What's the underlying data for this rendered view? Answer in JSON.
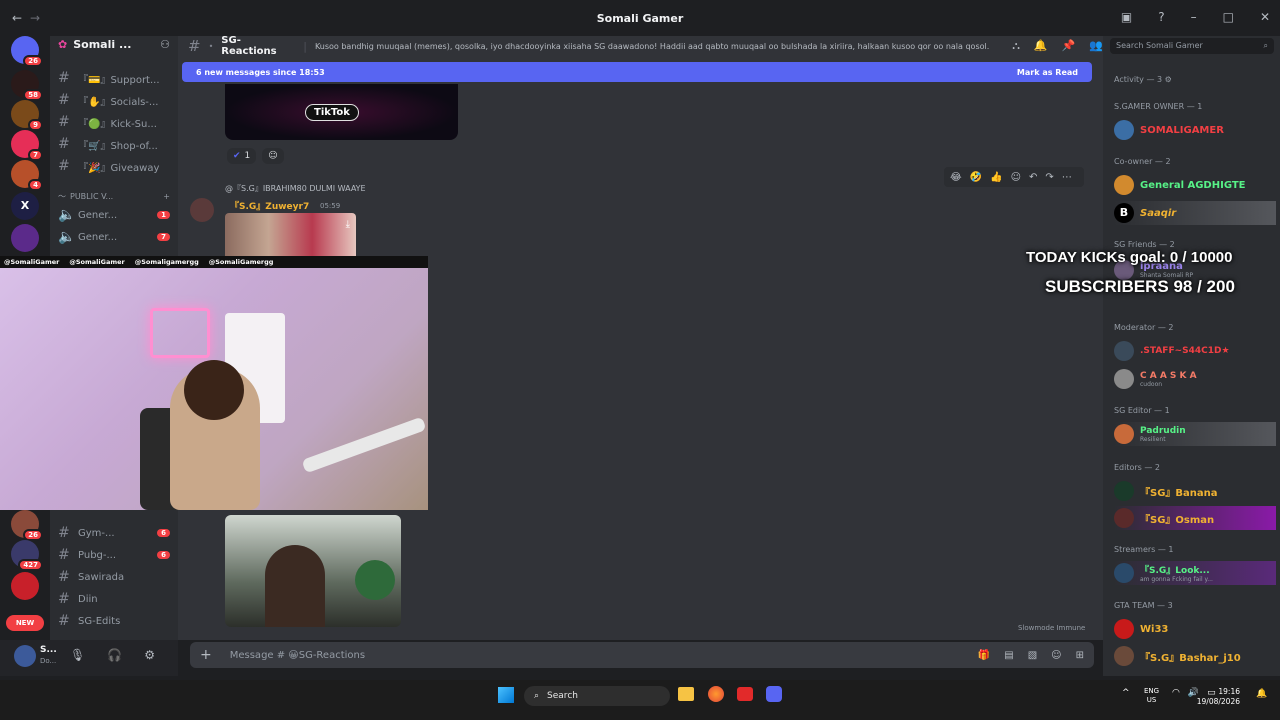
{
  "window": {
    "title": "Somali Gamer",
    "back": "←",
    "forward": "→"
  },
  "server": {
    "name": "Somali ...",
    "rail_badges": [
      "26",
      "58",
      "9",
      "7",
      "4"
    ]
  },
  "channels": [
    {
      "label": "『💳』Support...",
      "badge": ""
    },
    {
      "label": "『✋』Socials-...",
      "badge": ""
    },
    {
      "label": "『🟢』Kick-Su...",
      "badge": ""
    },
    {
      "label": "『🛒』Shop-of...",
      "badge": ""
    },
    {
      "label": "『🎉』Giveaway",
      "badge": ""
    }
  ],
  "voice_category": "PUBLIC V...",
  "voice_channels": [
    {
      "label": "Gener...",
      "badge": "1"
    },
    {
      "label": "Gener...",
      "badge": "7"
    }
  ],
  "lower_channels": [
    {
      "label": "Gym-...",
      "badge": "6"
    },
    {
      "label": "Pubg-...",
      "badge": "6"
    },
    {
      "label": "Sawirada",
      "badge": ""
    },
    {
      "label": "Diin",
      "badge": ""
    },
    {
      "label": "SG-Edits",
      "badge": ""
    }
  ],
  "lower_rail_badges": [
    "26",
    "427"
  ],
  "rail_new": "NEW",
  "user_panel": {
    "name": "S...",
    "status": "Do..."
  },
  "header": {
    "channel": "SG-Reactions",
    "topic": "Kusoo bandhig muuqaal (memes), qosolka, iyo dhacdooyinka xiisaha SG daawadono! Haddii aad qabto muuqaal oo bulshada la xiriira, halkaan kusoo qor oo nala qosol."
  },
  "new_messages": {
    "text": "6 new messages since 18:53",
    "action": "Mark as Read"
  },
  "tiktok_label": "TikTok",
  "reactions": [
    {
      "emoji": "✔",
      "count": "1"
    }
  ],
  "message": {
    "reply": "@『S.G』IBRAHIM80 DULMI WAAYE",
    "author": "『S.G』Zuweyr7",
    "time": "05:59"
  },
  "slowmode": "Slowmode Immune",
  "composer": {
    "placeholder": "Message # 😀SG-Reactions"
  },
  "member_search": "Search Somali Gamer",
  "activity": "Activity — 3",
  "member_groups": [
    {
      "header": "S.GAMER OWNER — 1",
      "members": [
        {
          "name": "SOMALIGAMER",
          "sub": "",
          "color": "#f23f43"
        }
      ]
    },
    {
      "header": "Co-owner — 2",
      "members": [
        {
          "name": "General AGDHIGTE",
          "sub": "",
          "color": "#57f287"
        },
        {
          "name": "Saaqir",
          "sub": "",
          "color": "#f0b232"
        }
      ]
    },
    {
      "header": "SG Friends — 2",
      "members": [
        {
          "name": "ipraana",
          "sub": "Shanta Somali RP",
          "color": "#9b84ec"
        }
      ]
    },
    {
      "header": "Moderator — 2",
      "members": [
        {
          "name": ".STAFF~S44C1D★",
          "sub": "",
          "color": "#f23f43"
        },
        {
          "name": "C A A S K A",
          "sub": "cudoon",
          "color": "#f47b67"
        }
      ]
    },
    {
      "header": "SG Editor — 1",
      "members": [
        {
          "name": "Padrudin",
          "sub": "Resilient",
          "color": "#57f287"
        }
      ]
    },
    {
      "header": "Editors — 2",
      "members": [
        {
          "name": "『SG』Banana",
          "sub": "",
          "color": "#f0b232"
        },
        {
          "name": "『SG』Osman",
          "sub": "",
          "color": "#f0b232"
        }
      ]
    },
    {
      "header": "Streamers — 1",
      "members": [
        {
          "name": "『S.G』Look...",
          "sub": "am gonna Fcking fail y...",
          "color": "#57f287"
        }
      ]
    },
    {
      "header": "GTA TEAM — 3",
      "members": [
        {
          "name": "Wi33",
          "sub": "",
          "color": "#f0b232"
        },
        {
          "name": "『S.G』Bashar_j10",
          "sub": "",
          "color": "#f0b232"
        }
      ]
    }
  ],
  "stream_overlay": {
    "kicks_goal": "TODAY KICKs goal: 0 / 10000",
    "subscribers": "SUBSCRIBERS 98 / 200",
    "socials": [
      "@SomaliGamer",
      "@SomaliGamer",
      "@Somaligamergg",
      "@SomaliGamergg"
    ]
  },
  "taskbar": {
    "search": "Search",
    "lang1": "ENG",
    "lang2": "US",
    "time": "19:16",
    "date": "19/08/2026"
  }
}
